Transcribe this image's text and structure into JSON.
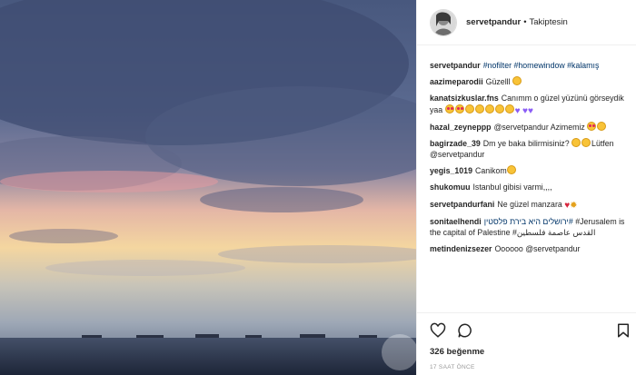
{
  "header": {
    "username": "servetpandur",
    "separator": "•",
    "follow_status": "Takiptesin"
  },
  "caption": {
    "user": "servetpandur",
    "text": "#nofilter #homewindow #kalamış"
  },
  "comments": [
    {
      "user": "aazimeparodii",
      "text": "Güzelll"
    },
    {
      "user": "kanatsizkuslar.fns",
      "text": "Canımm o güzel yüzünü görseydik yaa"
    },
    {
      "user": "hazal_zeyneppp",
      "text": "@servetpandur Azimemiz"
    },
    {
      "user": "bagirzade_39",
      "text": "Dm ye baka bilirmisiniz?",
      "text2": "Lütfen @servetpandur"
    },
    {
      "user": "yegis_1019",
      "text": "Canikom"
    },
    {
      "user": "shukomuu",
      "text": "Istanbul gibisi varmi,,,,"
    },
    {
      "user": "servetpandurfani",
      "text": "Ne güzel manzara"
    },
    {
      "user": "sonitaelhendi",
      "text": "#ירושלים היא בירת פלסטין",
      "text2": "#Jerusalem is the capital of Palestine",
      "text3": "القدس عاصمة فلسطين#"
    },
    {
      "user": "metindenizsezer",
      "text": "Oooooo @servetpandur"
    }
  ],
  "footer": {
    "likes": "326 beğenme",
    "time": "17 SAAT ÖNCE"
  },
  "icons": {
    "like": "heart-outline-icon",
    "comment": "comment-bubble-icon",
    "save": "bookmark-icon"
  },
  "colors": {
    "link": "#003569",
    "text": "#262626",
    "muted": "#999999"
  }
}
